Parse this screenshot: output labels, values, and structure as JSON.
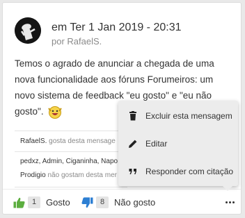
{
  "post": {
    "date": "em Ter 1 Jan 2019 - 20:31",
    "author": "por RafaelS.",
    "body": "Temos o agrado de anunciar a chegada de uma nova funcionalidade aos fóruns Forumeiros: um novo sistema de feedback \"eu gosto\" e \"eu não gosto\".",
    "smiley_icon": "cheering-smiley-icon"
  },
  "likers": {
    "liked_user": "RafaelS.",
    "liked_text": " gosta desta mensage",
    "disliked_users": "pedxz, Admin, Ciganinha, Napo",
    "disliked_user_last": "Prodigio",
    "disliked_text": " não gostam desta mer"
  },
  "votes": {
    "like_count": "1",
    "like_label": "Gosto",
    "dislike_count": "8",
    "dislike_label": "Não gosto"
  },
  "menu": {
    "items": [
      {
        "label": "Excluir esta mensagem",
        "icon": "trash-icon"
      },
      {
        "label": "Editar",
        "icon": "pencil-icon"
      },
      {
        "label": "Responder com citação",
        "icon": "quote-icon"
      }
    ]
  },
  "colors": {
    "like_green": "#5cae3f",
    "dislike_blue": "#2d7fd3",
    "menu_bg": "#ececec",
    "avatar_bg": "#151515"
  }
}
